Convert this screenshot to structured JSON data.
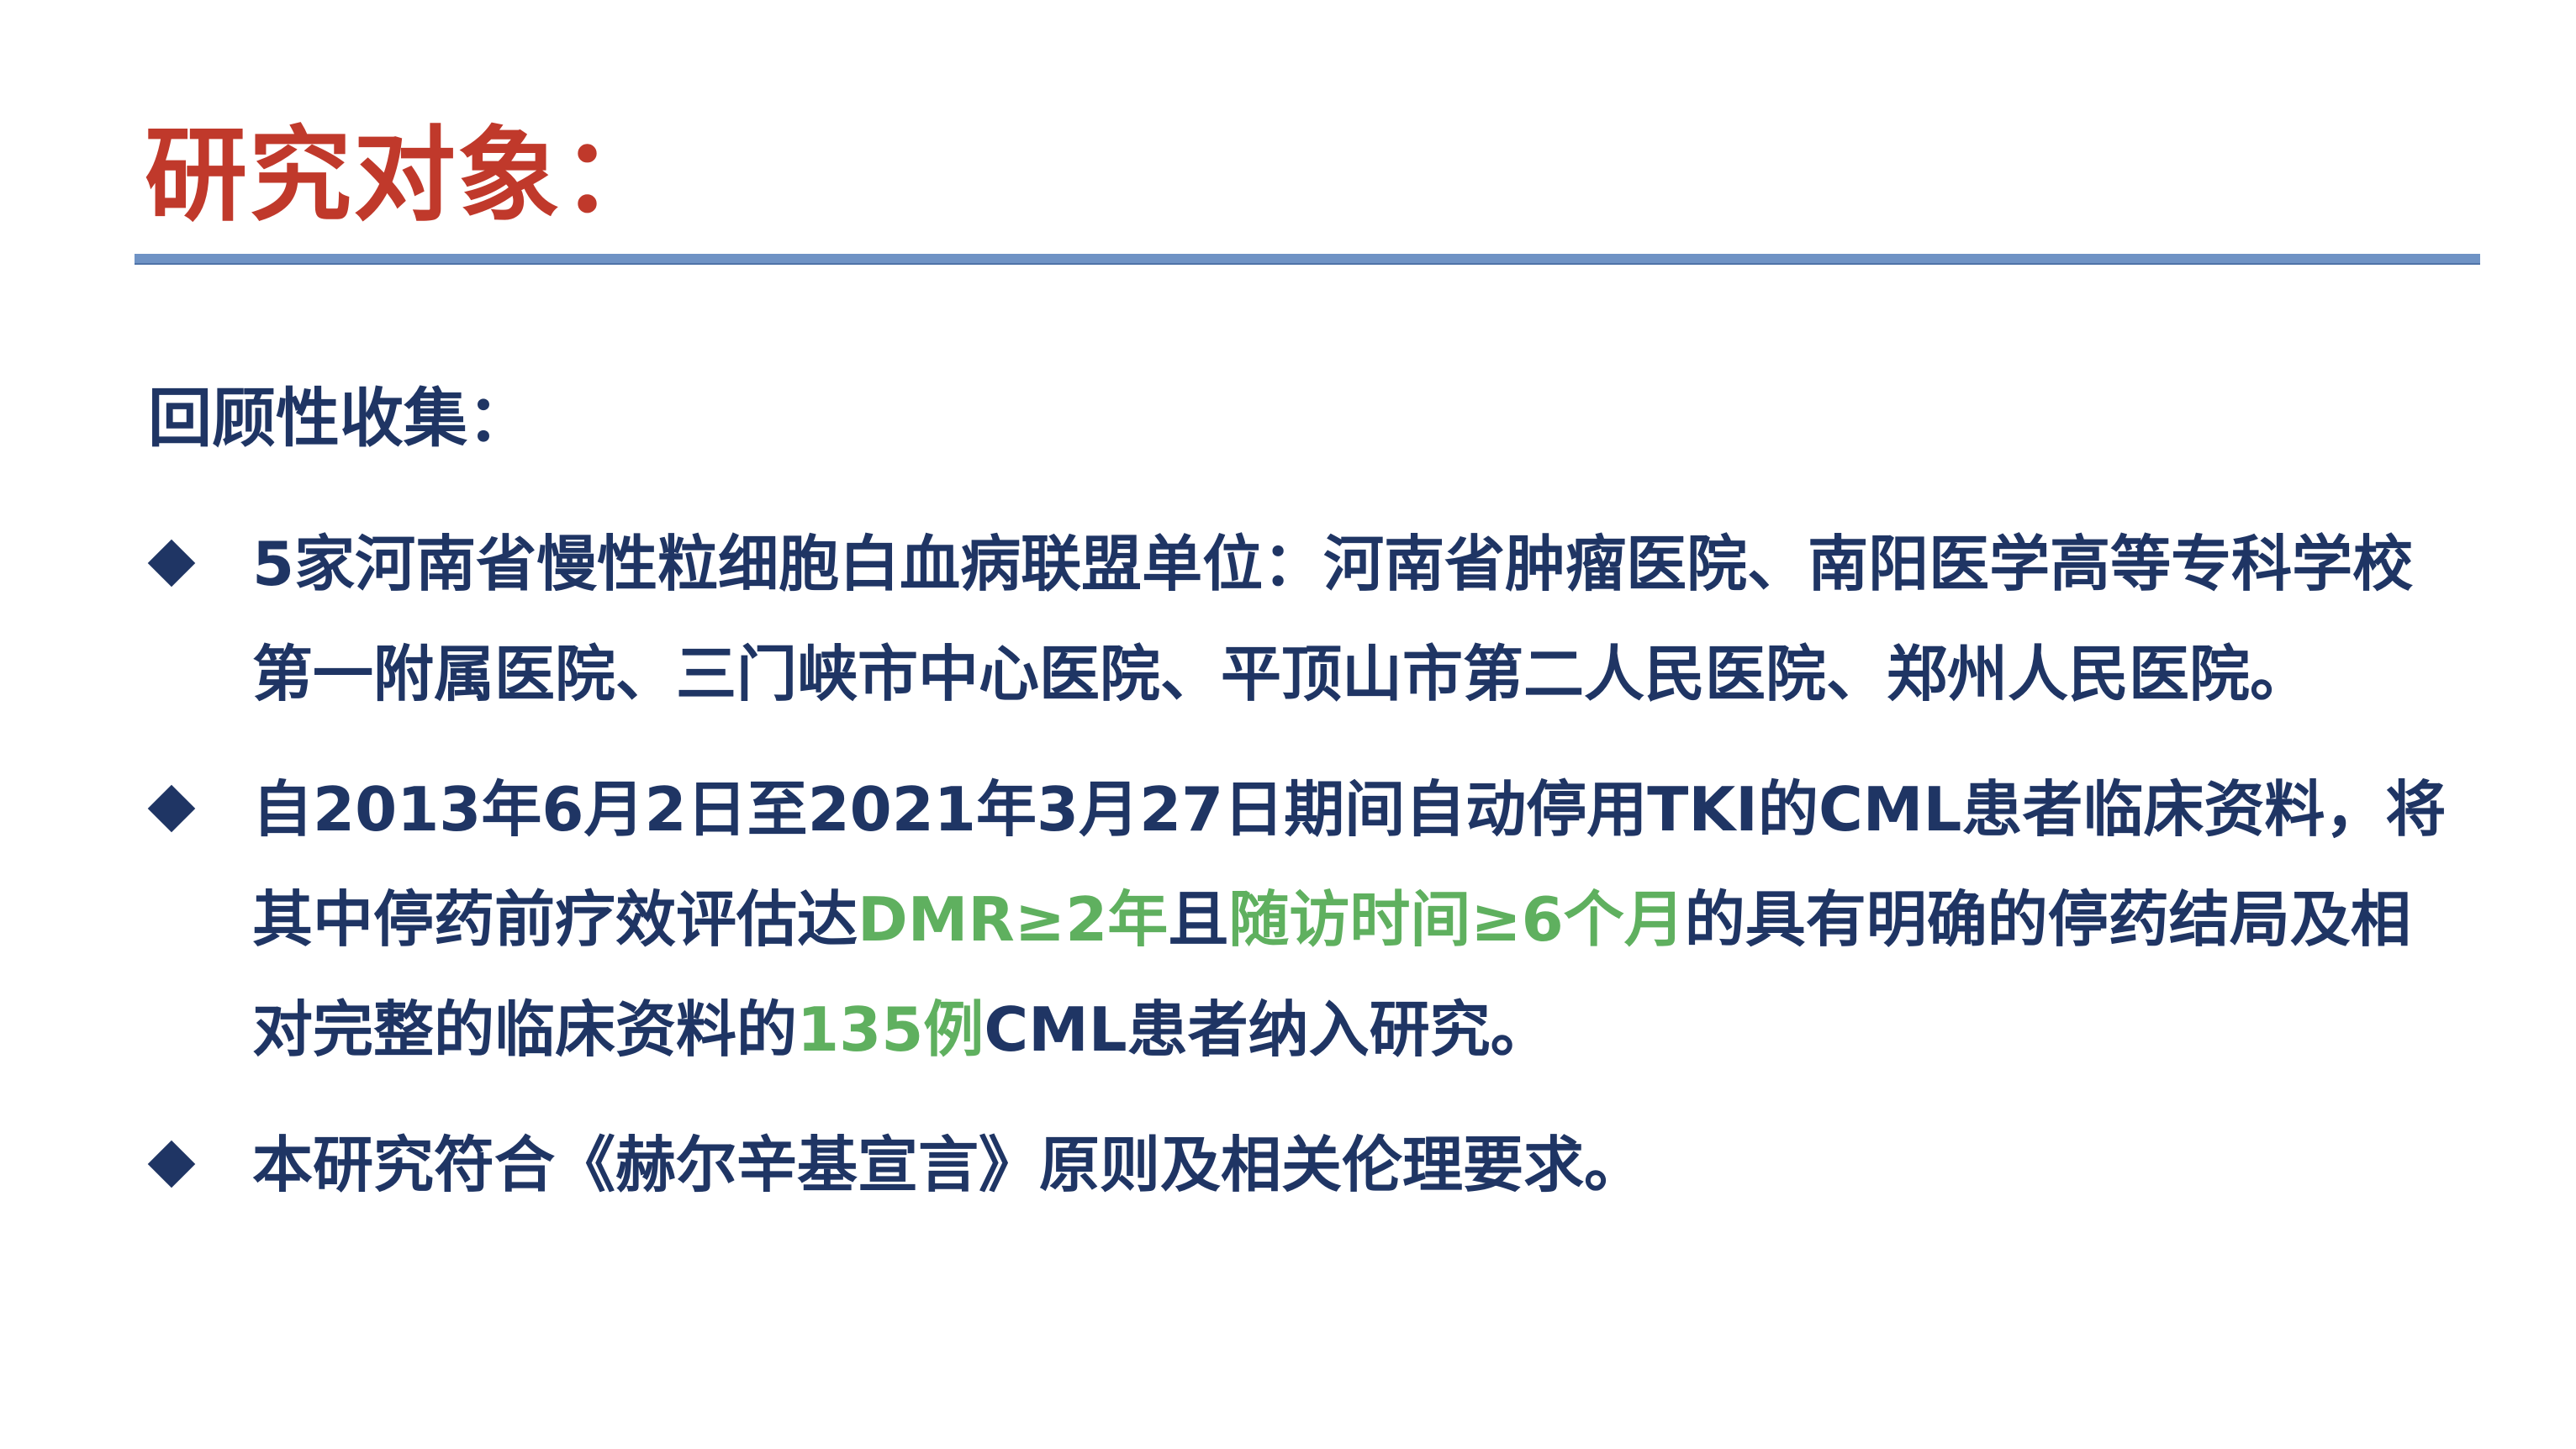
{
  "title": "研究对象：",
  "section_heading": "回顾性收集：",
  "colors": {
    "title": "#c0392b",
    "text": "#1f3564",
    "highlight": "#5fb05f",
    "rule": "#6f93c5"
  },
  "bullets": [
    {
      "text": "5家河南省慢性粒细胞白血病联盟单位：河南省肿瘤医院、南阳医学高等专科学校第一附属医院、三门峡市中心医院、平顶山市第二人民医院、郑州人民医院。"
    },
    {
      "seg1": "自2013年6月2日至2021年3月27日期间自动停用TKI的CML患者临床资料，将其中停药前疗效评估达",
      "hl1": "DMR≥2年",
      "seg2": "且",
      "hl2": "随访时间≥6个月",
      "seg3": "的具有明确的停药结局及相对完整的临床资料的",
      "hl3": "135例",
      "seg4": "CML患者纳入研究。"
    },
    {
      "text": "本研究符合《赫尔辛基宣言》原则及相关伦理要求。"
    }
  ]
}
